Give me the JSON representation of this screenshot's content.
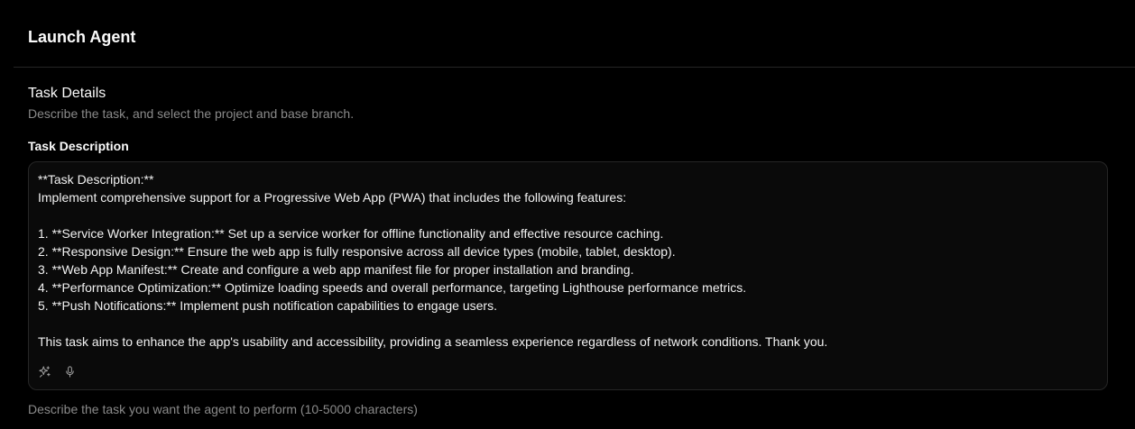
{
  "dialog": {
    "title": "Launch Agent"
  },
  "section": {
    "title": "Task Details",
    "description": "Describe the task, and select the project and base branch."
  },
  "task_field": {
    "label": "Task Description",
    "value": "**Task Description:**\nImplement comprehensive support for a Progressive Web App (PWA) that includes the following features:\n\n1. **Service Worker Integration:** Set up a service worker for offline functionality and effective resource caching.\n2. **Responsive Design:** Ensure the web app is fully responsive across all device types (mobile, tablet, desktop).\n3. **Web App Manifest:** Create and configure a web app manifest file for proper installation and branding.\n4. **Performance Optimization:** Optimize loading speeds and overall performance, targeting Lighthouse performance metrics.\n5. **Push Notifications:** Implement push notification capabilities to engage users.\n\nThis task aims to enhance the app's usability and accessibility, providing a seamless experience regardless of network conditions. Thank you.",
    "helper": "Describe the task you want the agent to perform (10-5000 characters)",
    "tools": [
      {
        "icon": "sparkles-icon"
      },
      {
        "icon": "microphone-icon"
      }
    ]
  },
  "colors": {
    "background": "#000000",
    "field_background": "#0a0a0a",
    "border": "#262626",
    "muted_text": "#8a8a8a"
  }
}
